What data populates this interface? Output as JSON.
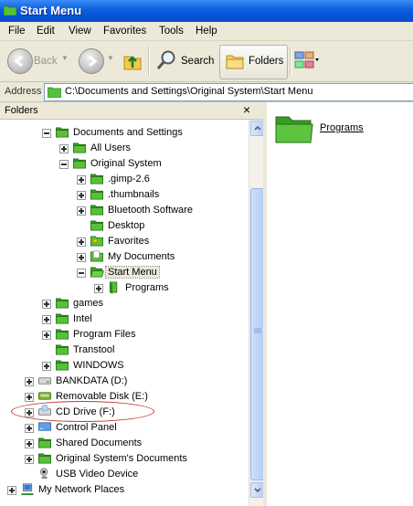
{
  "window": {
    "title": "Start Menu"
  },
  "menu": [
    "File",
    "Edit",
    "View",
    "Favorites",
    "Tools",
    "Help"
  ],
  "toolbar": {
    "back": "Back",
    "search": "Search",
    "folders": "Folders"
  },
  "address": {
    "label": "Address",
    "value": "C:\\Documents and Settings\\Original System\\Start Menu"
  },
  "folders_pane": {
    "title": "Folders",
    "close": "×"
  },
  "tree": [
    {
      "label": "Documents and Settings",
      "expander": "minus",
      "icon": "folder-icon"
    },
    {
      "label": "All Users",
      "expander": "plus",
      "icon": "folder-icon"
    },
    {
      "label": "Original System",
      "expander": "minus",
      "icon": "folder-icon"
    },
    {
      "label": ".gimp-2.6",
      "expander": "plus",
      "icon": "folder-icon"
    },
    {
      "label": ".thumbnails",
      "expander": "plus",
      "icon": "folder-icon"
    },
    {
      "label": "Bluetooth Software",
      "expander": "plus",
      "icon": "folder-icon"
    },
    {
      "label": "Desktop",
      "expander": "",
      "icon": "folder-icon"
    },
    {
      "label": "Favorites",
      "expander": "plus",
      "icon": "favorites-folder-icon"
    },
    {
      "label": "My Documents",
      "expander": "plus",
      "icon": "documents-folder-icon"
    },
    {
      "label": "Start Menu",
      "expander": "minus",
      "icon": "folder-open-icon"
    },
    {
      "label": "Programs",
      "expander": "plus",
      "icon": "programs-folder-icon"
    },
    {
      "label": "games",
      "expander": "plus",
      "icon": "folder-icon"
    },
    {
      "label": "Intel",
      "expander": "plus",
      "icon": "folder-icon"
    },
    {
      "label": "Program Files",
      "expander": "plus",
      "icon": "folder-icon"
    },
    {
      "label": "Transtool",
      "expander": "",
      "icon": "folder-icon"
    },
    {
      "label": "WINDOWS",
      "expander": "plus",
      "icon": "folder-icon"
    },
    {
      "label": "BANKDATA (D:)",
      "expander": "plus",
      "icon": "drive-icon"
    },
    {
      "label": "Removable Disk (E:)",
      "expander": "plus",
      "icon": "removable-disk-icon"
    },
    {
      "label": "CD Drive (F:)",
      "expander": "plus",
      "icon": "cd-drive-icon"
    },
    {
      "label": "Control Panel",
      "expander": "plus",
      "icon": "control-panel-icon"
    },
    {
      "label": "Shared Documents",
      "expander": "plus",
      "icon": "folder-icon"
    },
    {
      "label": "Original System's Documents",
      "expander": "plus",
      "icon": "folder-icon"
    },
    {
      "label": "USB Video Device",
      "expander": "",
      "icon": "webcam-icon"
    },
    {
      "label": "My Network Places",
      "expander": "plus",
      "icon": "network-places-icon"
    }
  ],
  "content": {
    "items": [
      {
        "label": "Programs",
        "icon": "folder-icon"
      }
    ]
  },
  "colors": {
    "folder": "#3fae2a",
    "titlebar": "#0a5fe0",
    "highlight": "#c0392b"
  }
}
